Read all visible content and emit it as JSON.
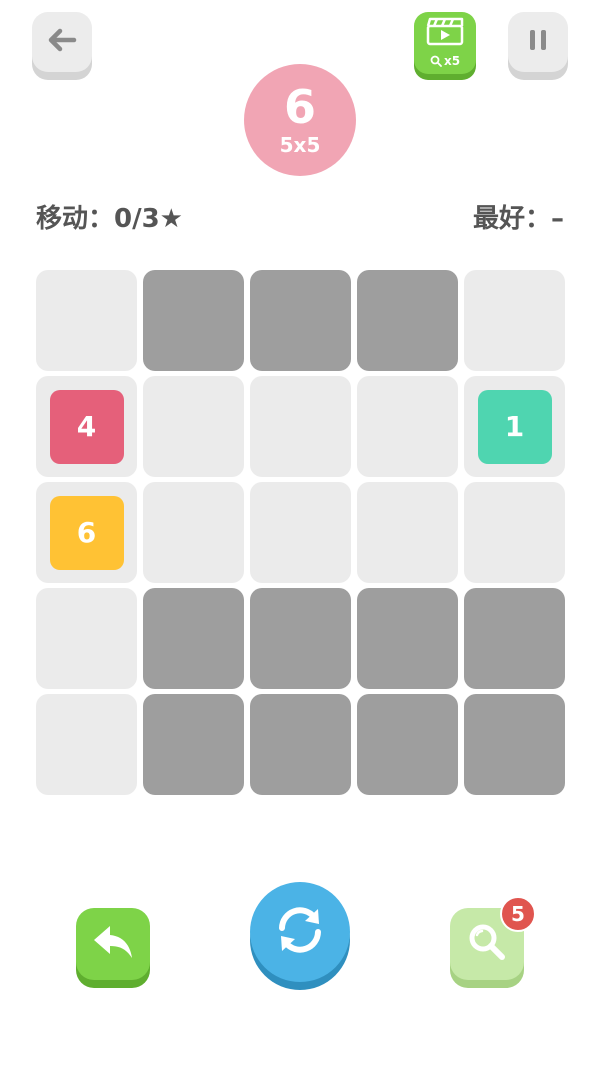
{
  "header": {
    "back_icon": "arrow-left-icon",
    "pause_icon": "pause-icon",
    "video_icon": "clapperboard-icon",
    "video_reward_label": "x5",
    "level": "6",
    "board_size": "5x5",
    "level_color": "#f1a5b4"
  },
  "stats": {
    "moves_label": "移动：0/3★",
    "best_label": "最好：–"
  },
  "board": {
    "rows": 5,
    "cols": 5,
    "cells": [
      [
        "empty",
        "blocked",
        "blocked",
        "blocked",
        "empty"
      ],
      [
        "tile",
        "empty",
        "empty",
        "empty",
        "tile"
      ],
      [
        "tile",
        "empty",
        "empty",
        "empty",
        "empty"
      ],
      [
        "empty",
        "blocked",
        "blocked",
        "blocked",
        "blocked"
      ],
      [
        "empty",
        "blocked",
        "blocked",
        "blocked",
        "blocked"
      ]
    ],
    "tiles": [
      {
        "row": 1,
        "col": 0,
        "value": "4",
        "color": "#e5607a"
      },
      {
        "row": 1,
        "col": 4,
        "value": "1",
        "color": "#4fd5b0"
      },
      {
        "row": 2,
        "col": 0,
        "value": "6",
        "color": "#ffc234"
      }
    ],
    "empty_color": "#ebebeb",
    "blocked_color": "#9e9e9e"
  },
  "controls": {
    "undo_icon": "undo-arrow-icon",
    "restart_icon": "restart-icon",
    "hint_icon": "magnifier-icon",
    "hint_count": "5"
  }
}
